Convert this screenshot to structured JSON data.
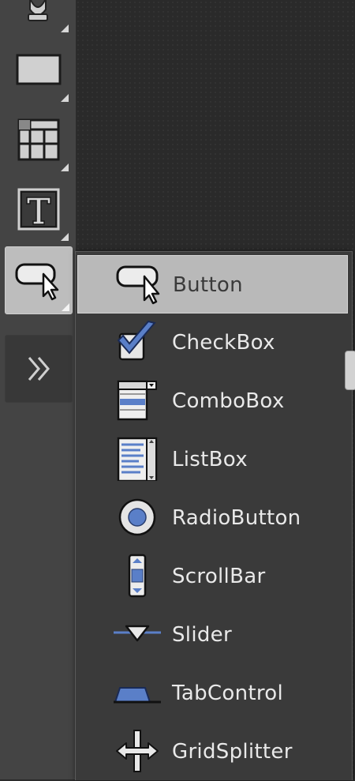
{
  "menu": {
    "items": [
      {
        "label": "Button",
        "icon": "button-icon"
      },
      {
        "label": "CheckBox",
        "icon": "checkbox-icon"
      },
      {
        "label": "ComboBox",
        "icon": "combobox-icon"
      },
      {
        "label": "ListBox",
        "icon": "listbox-icon"
      },
      {
        "label": "RadioButton",
        "icon": "radiobutton-icon"
      },
      {
        "label": "ScrollBar",
        "icon": "scrollbar-icon"
      },
      {
        "label": "Slider",
        "icon": "slider-icon"
      },
      {
        "label": "TabControl",
        "icon": "tabcontrol-icon"
      },
      {
        "label": "GridSplitter",
        "icon": "gridsplitter-icon"
      }
    ],
    "selected": "Button"
  },
  "toolbox": {
    "tools": [
      "asset-tool-icon",
      "rectangle-tool-icon",
      "grid-tool-icon",
      "text-tool-icon",
      "button-tool-icon",
      "more-tools-icon"
    ]
  },
  "colors": {
    "accent": "#5a7fc8",
    "selected_bg": "#b9b9b9",
    "panel_bg": "#3a3a3a",
    "toolbox_bg": "#444444"
  }
}
